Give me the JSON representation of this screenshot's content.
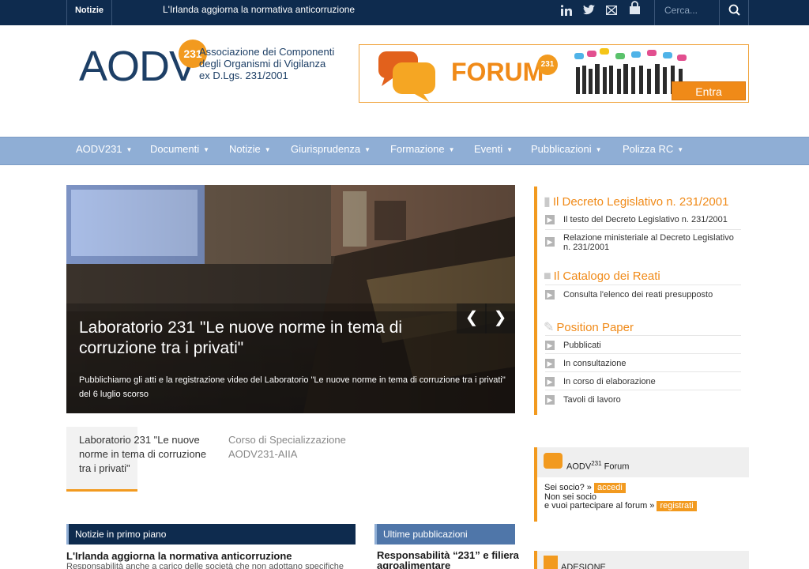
{
  "topbar": {
    "news_label": "Notizie",
    "ticker": "L'Irlanda aggiorna la normativa anticorruzione",
    "search_placeholder": "Cerca..."
  },
  "logo": {
    "main": "AODV",
    "badge": "231",
    "sub_line1": "Associazione dei Componenti",
    "sub_line2": "degli Organismi di Vigilanza",
    "sub_line3": "ex D.Lgs. 231/2001"
  },
  "forum_banner": {
    "text": "FORUM",
    "badge": "231",
    "button": "Entra"
  },
  "nav": {
    "items": [
      "AODV231",
      "Documenti",
      "Notizie",
      "Giurisprudenza",
      "Formazione",
      "Eventi",
      "Pubblicazioni",
      "Polizza RC"
    ]
  },
  "slider": {
    "title": "Laboratorio 231 \"Le nuove norme in tema di corruzione tra i privati\"",
    "description": "Pubblichiamo gli atti e la registrazione video del Laboratorio \"Le nuove norme in tema di corruzione tra i privati\" del 6 luglio scorso",
    "thumbs": [
      "Laboratorio 231 \"Le nuove norme in tema di corruzione tra i privati\"",
      "Corso di Specializzazione AODV231-AIIA"
    ]
  },
  "news": {
    "header": "Notizie in primo piano",
    "title": "L'Irlanda aggiorna la normativa anticorruzione",
    "snippet": "Responsabilità anche a carico delle società che non adottano specifiche"
  },
  "publications": {
    "header": "Ultime pubblicazioni",
    "title": "Responsabilità “231” e filiera agroalimentare"
  },
  "sidebar": {
    "decreto_heading": "Il Decreto Legislativo n. 231/2001",
    "decreto_links": [
      "Il testo del Decreto Legislativo n. 231/2001",
      "Relazione ministeriale al Decreto Legislativo n. 231/2001"
    ],
    "catalogo_heading": "Il Catalogo dei Reati",
    "catalogo_links": [
      "Consulta l'elenco dei reati presupposto"
    ],
    "position_heading": "Position Paper",
    "position_links": [
      "Pubblicati",
      "In consultazione",
      "In corso di elaborazione",
      "Tavoli di lavoro"
    ]
  },
  "forum_box": {
    "title": "AODV",
    "title_sup": "231",
    "title_suffix": " Forum",
    "line1": "Sei socio? »",
    "btn_login": "accedi",
    "line2": "Non sei socio",
    "line3": "e vuoi partecipare al forum »",
    "btn_register": "registrati"
  },
  "adesione": {
    "label": "ADESIONE"
  },
  "colors": {
    "navy": "#0e2b4e",
    "nav_blue": "#8faed5",
    "orange": "#f29a1f"
  }
}
